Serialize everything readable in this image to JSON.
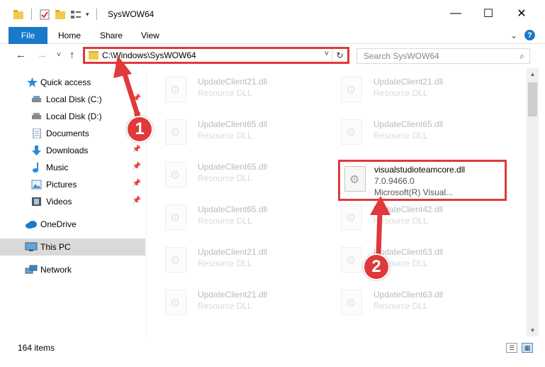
{
  "window": {
    "title": "SysWOW64",
    "minimize": "—",
    "maximize": "☐",
    "close": "✕"
  },
  "ribbon": {
    "file_tab": "File",
    "tabs": [
      "Home",
      "Share",
      "View"
    ],
    "expand": "⌄",
    "help": "?"
  },
  "nav": {
    "back": "←",
    "forward": "→",
    "recent": "˅",
    "up": "↑",
    "path": "C:\\Windows\\SysWOW64",
    "dropdown": "˅",
    "refresh": "↻",
    "search_placeholder": "Search SysWOW64",
    "search_icon": "⌕"
  },
  "sidebar": {
    "items": [
      {
        "label": "Quick access",
        "icon": "star-icon"
      },
      {
        "label": "Local Disk (C:)",
        "icon": "drive-icon",
        "pinned": true
      },
      {
        "label": "Local Disk (D:)",
        "icon": "drive-icon",
        "pinned": true
      },
      {
        "label": "Documents",
        "icon": "documents-icon",
        "pinned": true
      },
      {
        "label": "Downloads",
        "icon": "download-icon",
        "pinned": true
      },
      {
        "label": "Music",
        "icon": "music-icon",
        "pinned": true
      },
      {
        "label": "Pictures",
        "icon": "pictures-icon",
        "pinned": true
      },
      {
        "label": "Videos",
        "icon": "videos-icon",
        "pinned": true
      },
      {
        "label": "OneDrive",
        "icon": "cloud-icon"
      },
      {
        "label": "This PC",
        "icon": "computer-icon",
        "selected": true
      },
      {
        "label": "Network",
        "icon": "network-icon"
      }
    ],
    "pin_glyph": "📌"
  },
  "files": {
    "left": [
      {
        "name": "UpdateClient21.dll",
        "desc": "Resource DLL"
      },
      {
        "name": "UpdateClient65.dll",
        "desc": "Resource DLL"
      },
      {
        "name": "UpdateClient65.dll",
        "desc": "Resource DLL"
      },
      {
        "name": "UpdateClient65.dll",
        "desc": "Resource DLL"
      },
      {
        "name": "UpdateClient21.dll",
        "desc": "Resource DLL"
      },
      {
        "name": "UpdateClient21.dll",
        "desc": "Resource DLL"
      }
    ],
    "right": [
      {
        "name": "UpdateClient21.dll",
        "desc": "Resource DLL"
      },
      {
        "name": "UpdateClient65.dll",
        "desc": "Resource DLL"
      },
      {
        "name": "UpdateClient42.dll",
        "desc": "Resource DLL"
      },
      {
        "name": "UpdateClient63.dll",
        "desc": "Resource DLL"
      },
      {
        "name": "UpdateClient63.dll",
        "desc": "Resource DLL"
      }
    ],
    "highlighted": {
      "name": "visualstudioteamcore.dll",
      "version": "7.0.9466.0",
      "company": "Microsoft(R) Visual..."
    }
  },
  "status": {
    "count": "164 items"
  },
  "annotations": {
    "step1": "1",
    "step2": "2",
    "color": "#e0393b"
  },
  "colors": {
    "accent": "#1979ca",
    "highlight": "#e0393b",
    "selected_bg": "#d9d9d9"
  }
}
